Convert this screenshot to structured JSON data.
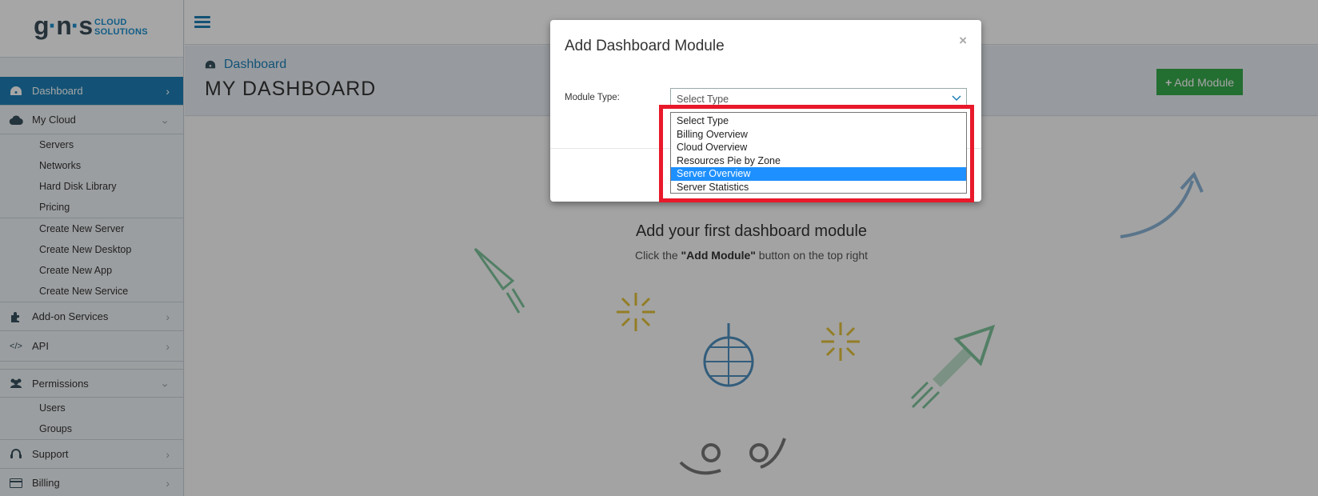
{
  "brand": {
    "logo_main": "g·n·s",
    "logo_sub_1": "CLOUD",
    "logo_sub_2": "SOLUTIONS"
  },
  "sidebar": {
    "dashboard": "Dashboard",
    "my_cloud": "My Cloud",
    "my_cloud_items": [
      "Servers",
      "Networks",
      "Hard Disk Library",
      "Pricing"
    ],
    "create_items": [
      "Create New Server",
      "Create New Desktop",
      "Create New App",
      "Create New Service"
    ],
    "addon": "Add-on Services",
    "api": "API",
    "permissions": "Permissions",
    "permissions_items": [
      "Users",
      "Groups"
    ],
    "support": "Support",
    "billing": "Billing"
  },
  "header": {
    "breadcrumb": "Dashboard",
    "title": "MY DASHBOARD",
    "add_module": "Add Module"
  },
  "empty_state": {
    "title": "Add your first dashboard module",
    "sub_prefix": "Click the ",
    "sub_bold": "\"Add Module\"",
    "sub_suffix": " button on the top right"
  },
  "modal": {
    "title": "Add Dashboard Module",
    "close": "×",
    "field_label": "Module Type:",
    "select_value": "Select Type",
    "options": [
      "Select Type",
      "Billing Overview",
      "Cloud Overview",
      "Resources Pie by Zone",
      "Server Overview",
      "Server Statistics"
    ],
    "highlighted_option": "Server Overview"
  },
  "colors": {
    "accent": "#1e7fb5",
    "success": "#36a94c",
    "highlight": "#e8192a",
    "option_selected": "#1e90ff"
  }
}
